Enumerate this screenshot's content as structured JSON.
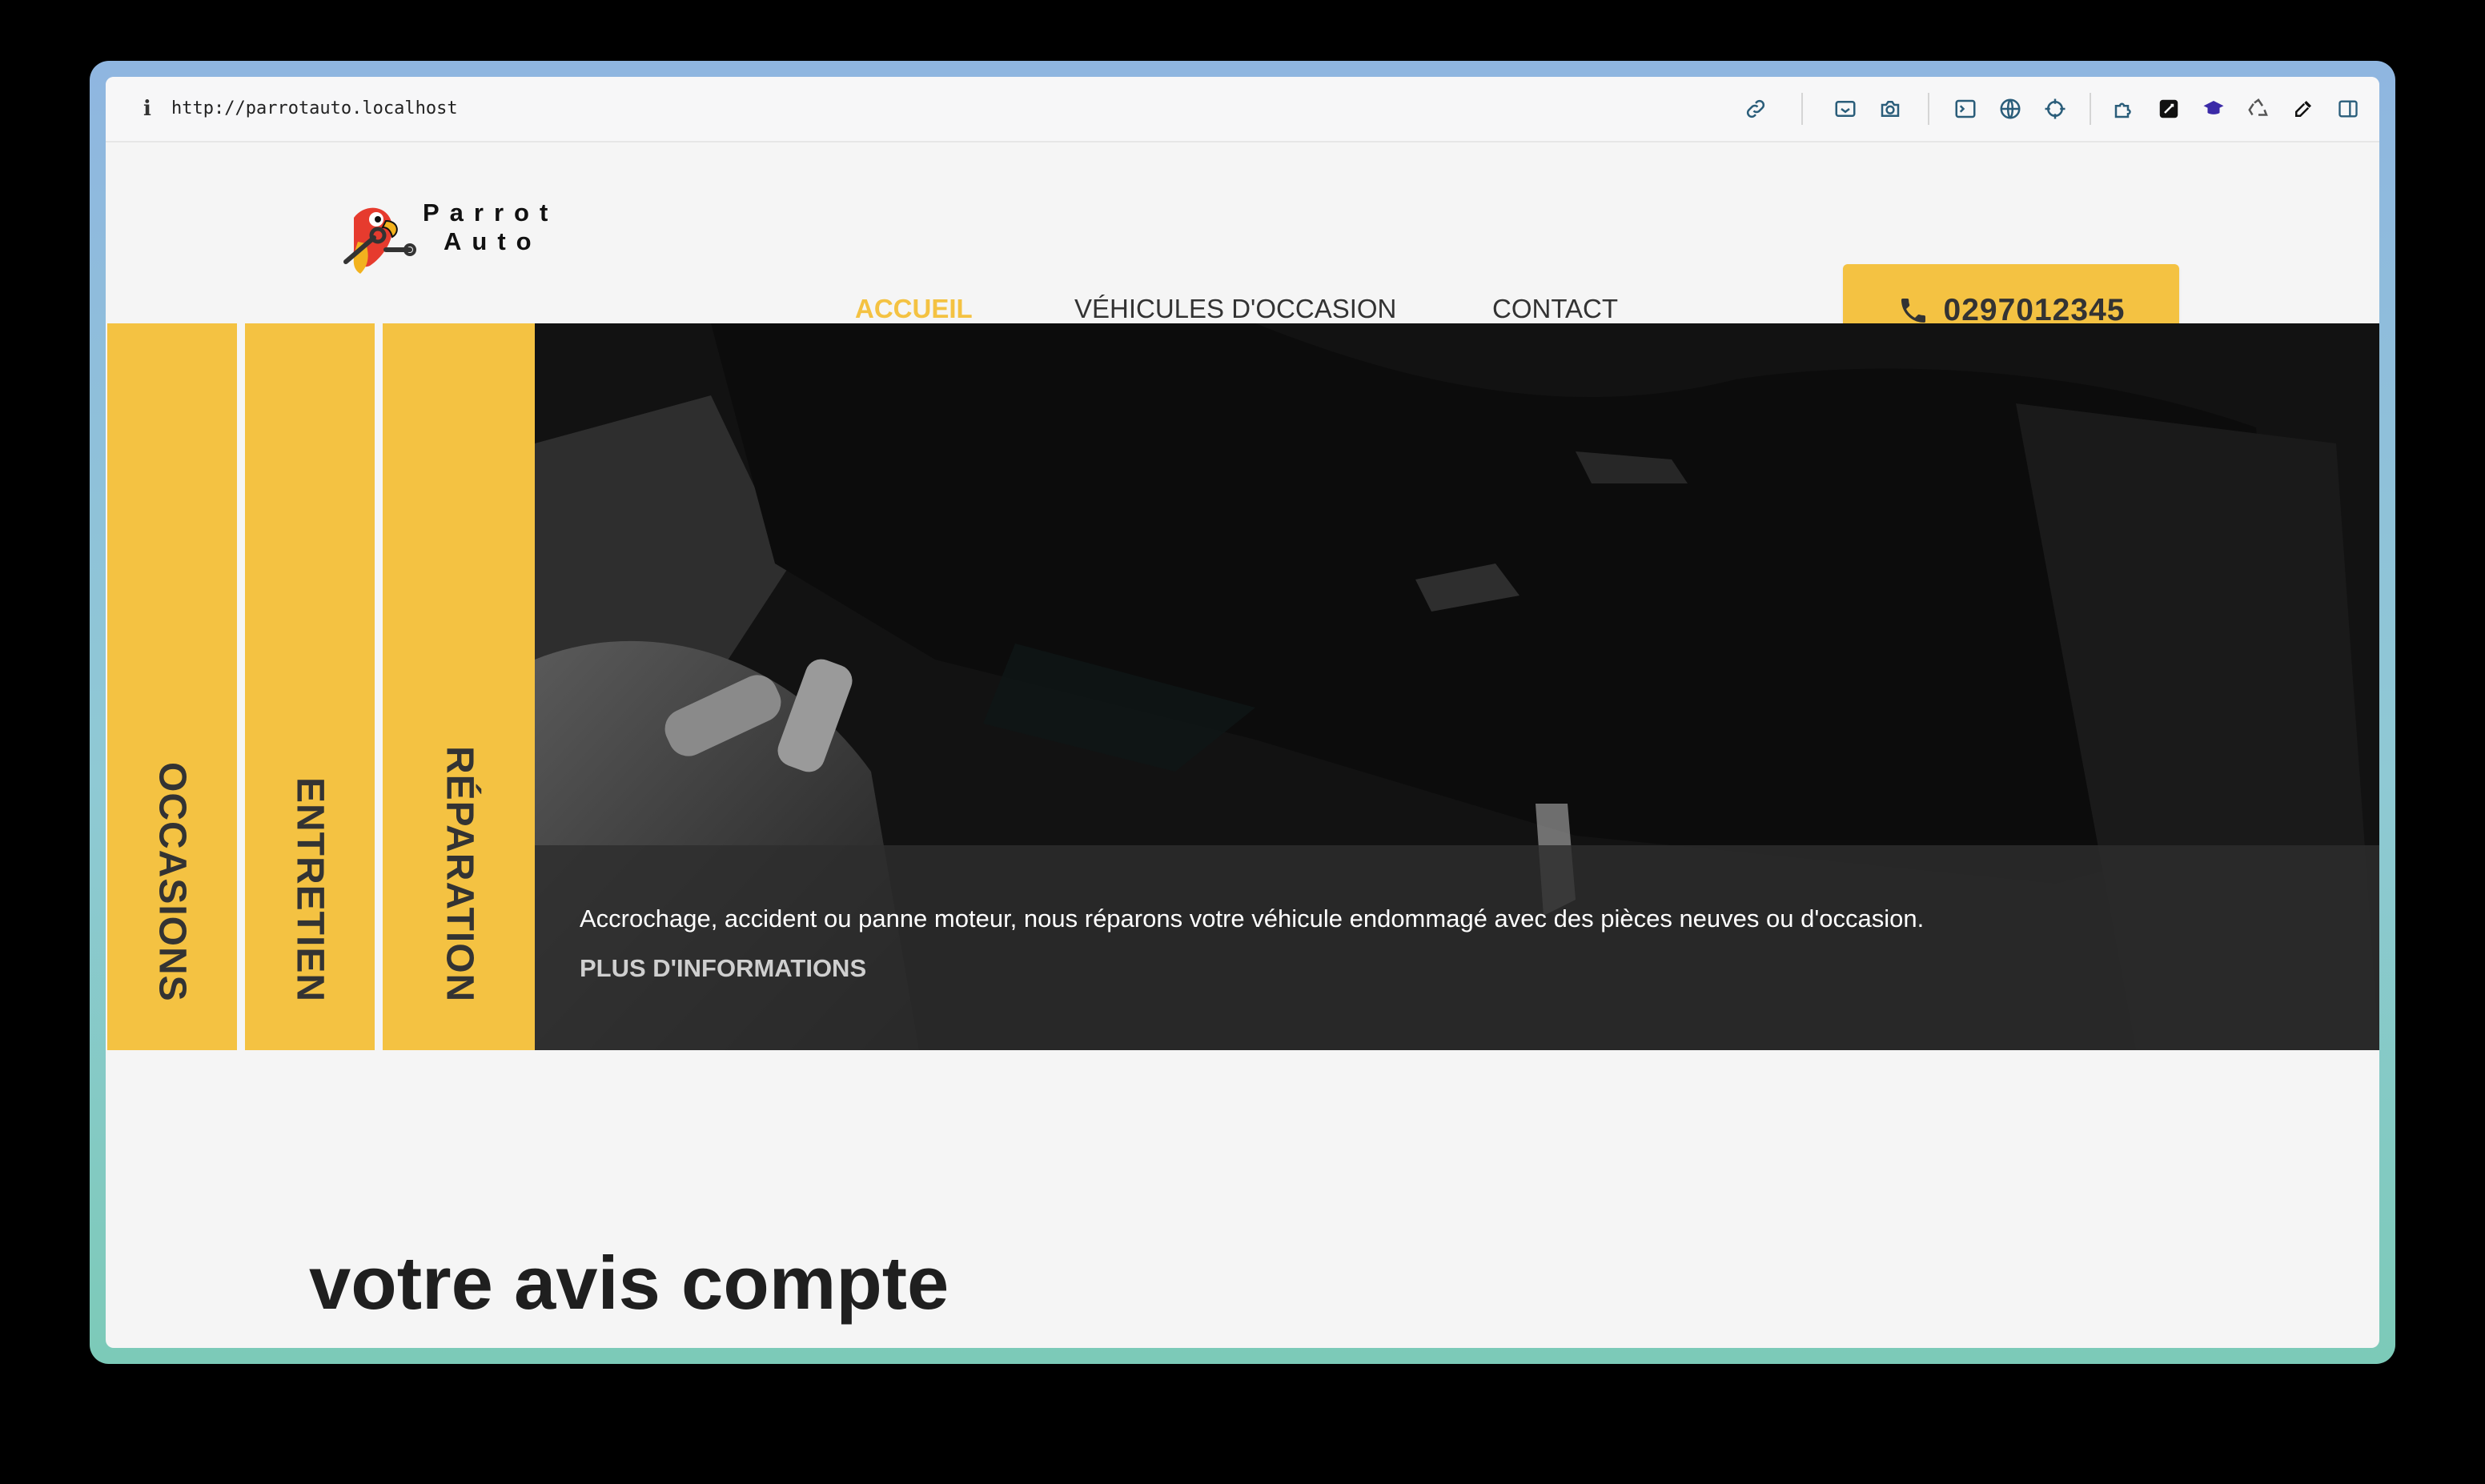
{
  "browser": {
    "url": "http://parrotauto.localhost",
    "toolbar_icons": [
      "link-icon",
      "screenshot-area-icon",
      "camera-icon",
      "terminal-icon",
      "globe-icon",
      "crosshair-icon",
      "extension-puzzle-icon",
      "compose-icon",
      "graduation-cap-icon",
      "recycle-icon",
      "eyedropper-icon",
      "sidebar-toggle-icon"
    ]
  },
  "header": {
    "logo_line1": "Parrot",
    "logo_line2": "Auto",
    "nav": [
      {
        "label": "ACCUEIL",
        "active": true
      },
      {
        "label": "VÉHICULES D'OCCASION",
        "active": false
      },
      {
        "label": "CONTACT",
        "active": false
      }
    ],
    "phone": "0297012345"
  },
  "hero": {
    "tabs": [
      "OCCASIONS",
      "ENTRETIEN",
      "RÉPARATION"
    ],
    "caption": "Accrochage, accident ou panne moteur, nous réparons votre véhicule endommagé avec des pièces neuves ou d'occasion.",
    "link": "PLUS D'INFORMATIONS"
  },
  "section": {
    "title": "votre avis compte"
  },
  "colors": {
    "accent": "#f4c242",
    "text_dark": "#333333",
    "page_bg": "#f5f5f5"
  }
}
